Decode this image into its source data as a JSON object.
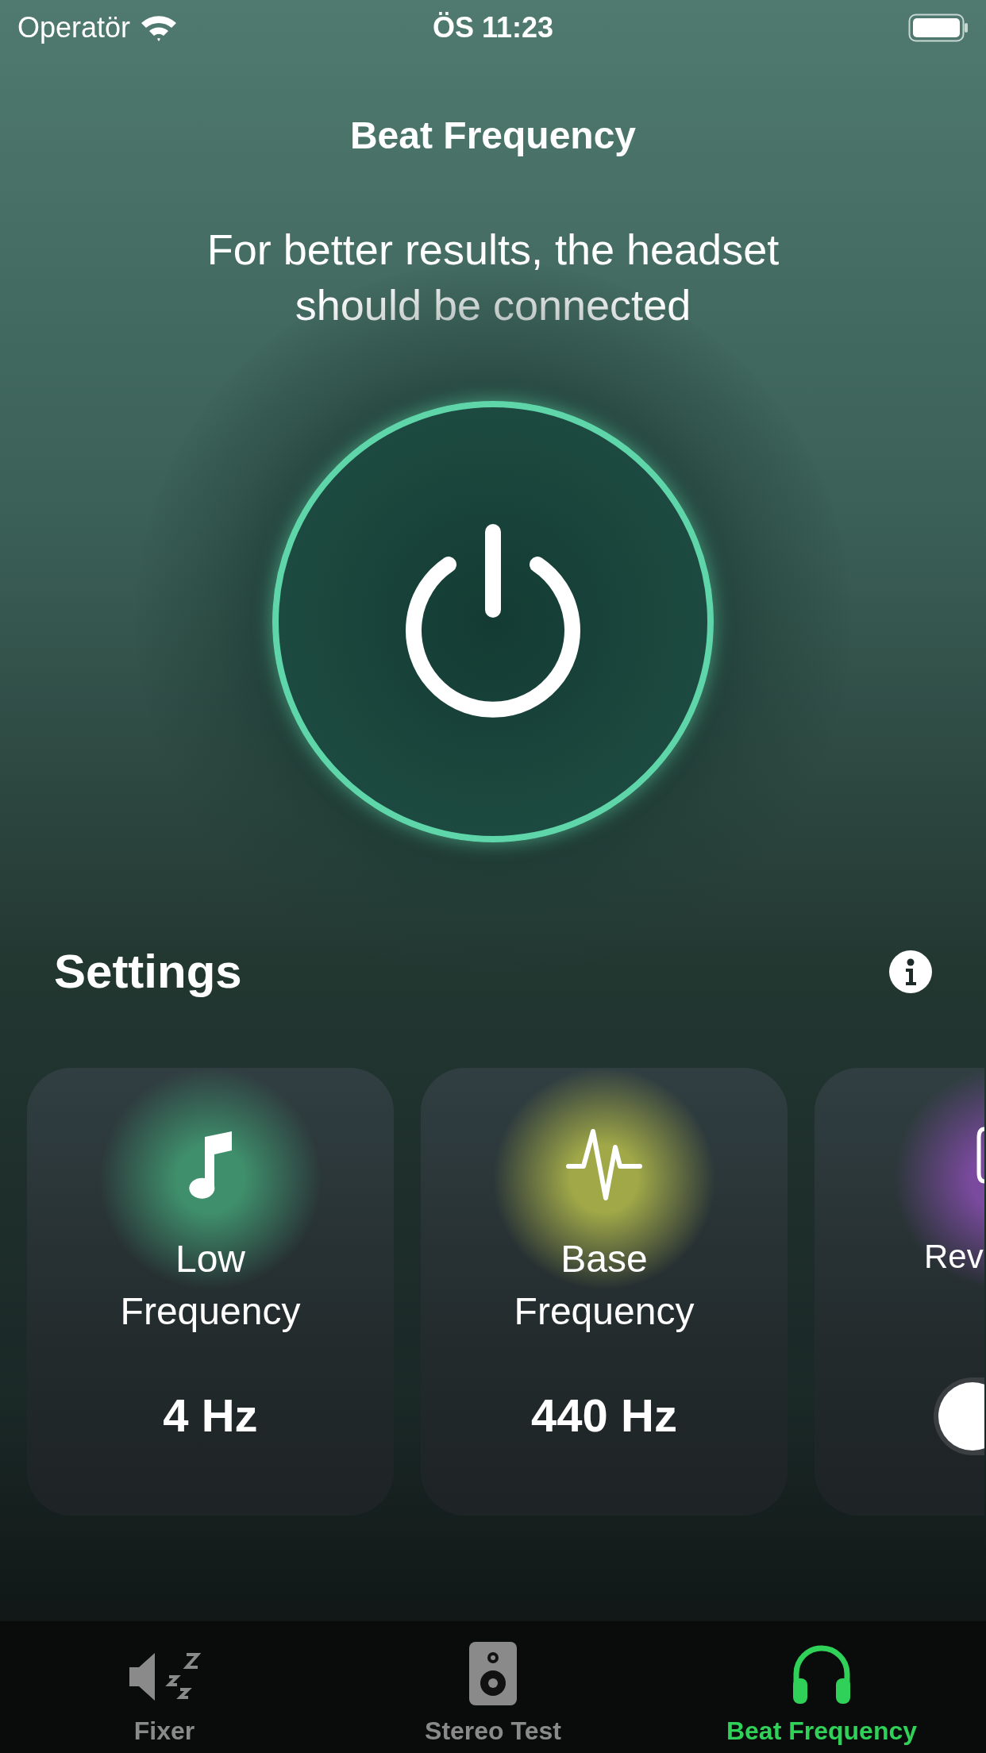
{
  "status_bar": {
    "carrier": "Operatör",
    "time": "ÖS 11:23"
  },
  "title": "Beat Frequency",
  "message": "For better results, the headset should be connected",
  "settings": {
    "title": "Settings",
    "cards": [
      {
        "kind": "value",
        "label": "Low Frequency",
        "value": "4 Hz",
        "color": "#3f8f6c"
      },
      {
        "kind": "value",
        "label": "Base Frequency",
        "value": "440 Hz",
        "color": "#a0a848"
      },
      {
        "kind": "toggle",
        "label": "Rev",
        "on": false,
        "color": "#7a4a9e"
      }
    ]
  },
  "tabs": [
    {
      "label": "Fixer",
      "selected": false
    },
    {
      "label": "Stereo Test",
      "selected": false
    },
    {
      "label": "Beat Frequency",
      "selected": true
    }
  ]
}
